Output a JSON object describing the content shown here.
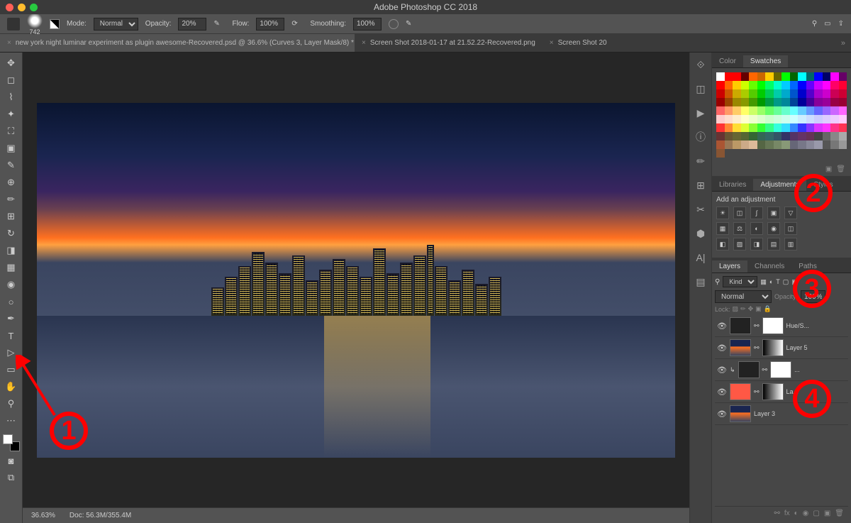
{
  "title": "Adobe Photoshop CC 2018",
  "options": {
    "brush_size": "742",
    "mode_label": "Mode:",
    "mode_value": "Normal",
    "opacity_label": "Opacity:",
    "opacity_value": "20%",
    "flow_label": "Flow:",
    "flow_value": "100%",
    "smoothing_label": "Smoothing:",
    "smoothing_value": "100%"
  },
  "tabs": [
    {
      "label": "new york night luminar experiment as plugin awesome-Recovered.psd @ 36.6% (Curves 3, Layer Mask/8) *",
      "active": true
    },
    {
      "label": "Screen Shot 2018-01-17 at 21.52.22-Recovered.png",
      "active": false
    },
    {
      "label": "Screen Shot 20",
      "active": false
    }
  ],
  "status": {
    "zoom": "36.63%",
    "doc": "Doc: 56.3M/355.4M"
  },
  "tools": [
    "move",
    "marquee",
    "lasso",
    "wand",
    "crop",
    "frame",
    "eyedropper",
    "heal",
    "brush",
    "clone",
    "history-brush",
    "eraser",
    "gradient",
    "blur",
    "dodge",
    "pen",
    "type",
    "path-select",
    "rectangle",
    "hand",
    "zoom",
    "more"
  ],
  "iconbar": [
    "history",
    "ruler",
    "play",
    "info",
    "brushes",
    "clone-source",
    "scissors",
    "3d",
    "type-panel",
    "measure"
  ],
  "swatch_tabs": {
    "color": "Color",
    "swatches": "Swatches"
  },
  "adj_tabs": {
    "libraries": "Libraries",
    "adjustments": "Adjustments",
    "styles": "Styles"
  },
  "adj_label": "Add an adjustment",
  "layer_tabs": {
    "layers": "Layers",
    "channels": "Channels",
    "paths": "Paths"
  },
  "layer_opts": {
    "kind_label": "Kind",
    "blend": "Normal",
    "opacity_label": "Opacity:",
    "opacity": "100%",
    "lock_label": "Lock:"
  },
  "layers": [
    {
      "name": "Hue/S...",
      "thumb": "adj",
      "mask": "mask"
    },
    {
      "name": "Layer 5",
      "thumb": "city",
      "mask": "grad"
    },
    {
      "name": "...",
      "thumb": "blank",
      "mask": "mask",
      "clipped": true
    },
    {
      "name": "La...",
      "thumb": "red",
      "mask": "grad"
    },
    {
      "name": "Layer 3",
      "thumb": "city",
      "mask": null
    }
  ],
  "swatches": [
    [
      "#ffffff",
      "#ff0000",
      "#ff0000",
      "#660000",
      "#ff6600",
      "#cc6600",
      "#ffcc00",
      "#666600",
      "#00ff00",
      "#006600",
      "#00ffff",
      "#006666",
      "#0000ff",
      "#000066",
      "#ff00ff",
      "#660066"
    ],
    [
      "#ff0000",
      "#ff6600",
      "#ffcc00",
      "#ccff00",
      "#66ff00",
      "#00ff00",
      "#00ff66",
      "#00ffcc",
      "#00ccff",
      "#0066ff",
      "#0000ff",
      "#6600ff",
      "#cc00ff",
      "#ff00ff",
      "#ff0066",
      "#ff0033"
    ],
    [
      "#cc0000",
      "#cc5500",
      "#ccaa00",
      "#aacc00",
      "#55cc00",
      "#00cc00",
      "#00cc55",
      "#00ccaa",
      "#00aacc",
      "#0055cc",
      "#0000cc",
      "#5500cc",
      "#aa00cc",
      "#cc00cc",
      "#cc0055",
      "#cc0033"
    ],
    [
      "#990000",
      "#994400",
      "#998800",
      "#889900",
      "#449900",
      "#009900",
      "#009944",
      "#009988",
      "#008899",
      "#004499",
      "#000099",
      "#440099",
      "#880099",
      "#990099",
      "#990044",
      "#990033"
    ],
    [
      "#ff6666",
      "#ff9966",
      "#ffcc66",
      "#ffff66",
      "#ccff66",
      "#99ff66",
      "#66ff66",
      "#66ff99",
      "#66ffcc",
      "#66ffff",
      "#66ccff",
      "#6699ff",
      "#6666ff",
      "#9966ff",
      "#cc66ff",
      "#ff66ff"
    ],
    [
      "#ffcccc",
      "#ffddcc",
      "#ffeecc",
      "#ffffcc",
      "#eeffcc",
      "#ddffcc",
      "#ccffcc",
      "#ccffdd",
      "#ccffee",
      "#ccffff",
      "#cceeff",
      "#ccddff",
      "#ccccff",
      "#ddccff",
      "#eeccff",
      "#ffccff"
    ],
    [
      "#ff3333",
      "#ff8833",
      "#ffdd33",
      "#ddff33",
      "#88ff33",
      "#33ff33",
      "#33ff88",
      "#33ffdd",
      "#33ddff",
      "#3388ff",
      "#3333ff",
      "#8833ff",
      "#dd33ff",
      "#ff33ff",
      "#ff3388",
      "#ff3355"
    ],
    [
      "#663333",
      "#665533",
      "#666633",
      "#556633",
      "#336633",
      "#336655",
      "#336666",
      "#335566",
      "#333366",
      "#553366",
      "#663366",
      "#663355",
      "#444444",
      "#666666",
      "#888888",
      "#aaaaaa"
    ],
    [
      "#aa5533",
      "#997755",
      "#bb9966",
      "#ccaa88",
      "#ddbb99",
      "#556644",
      "#667755",
      "#778866",
      "#889977",
      "#666677",
      "#777788",
      "#888899",
      "#9999aa",
      "#555555",
      "#777777",
      "#999999"
    ],
    [
      "#885533",
      "",
      "",
      "",
      "",
      "",
      "",
      "",
      "",
      "",
      "",
      "",
      "",
      "",
      "",
      ""
    ]
  ]
}
